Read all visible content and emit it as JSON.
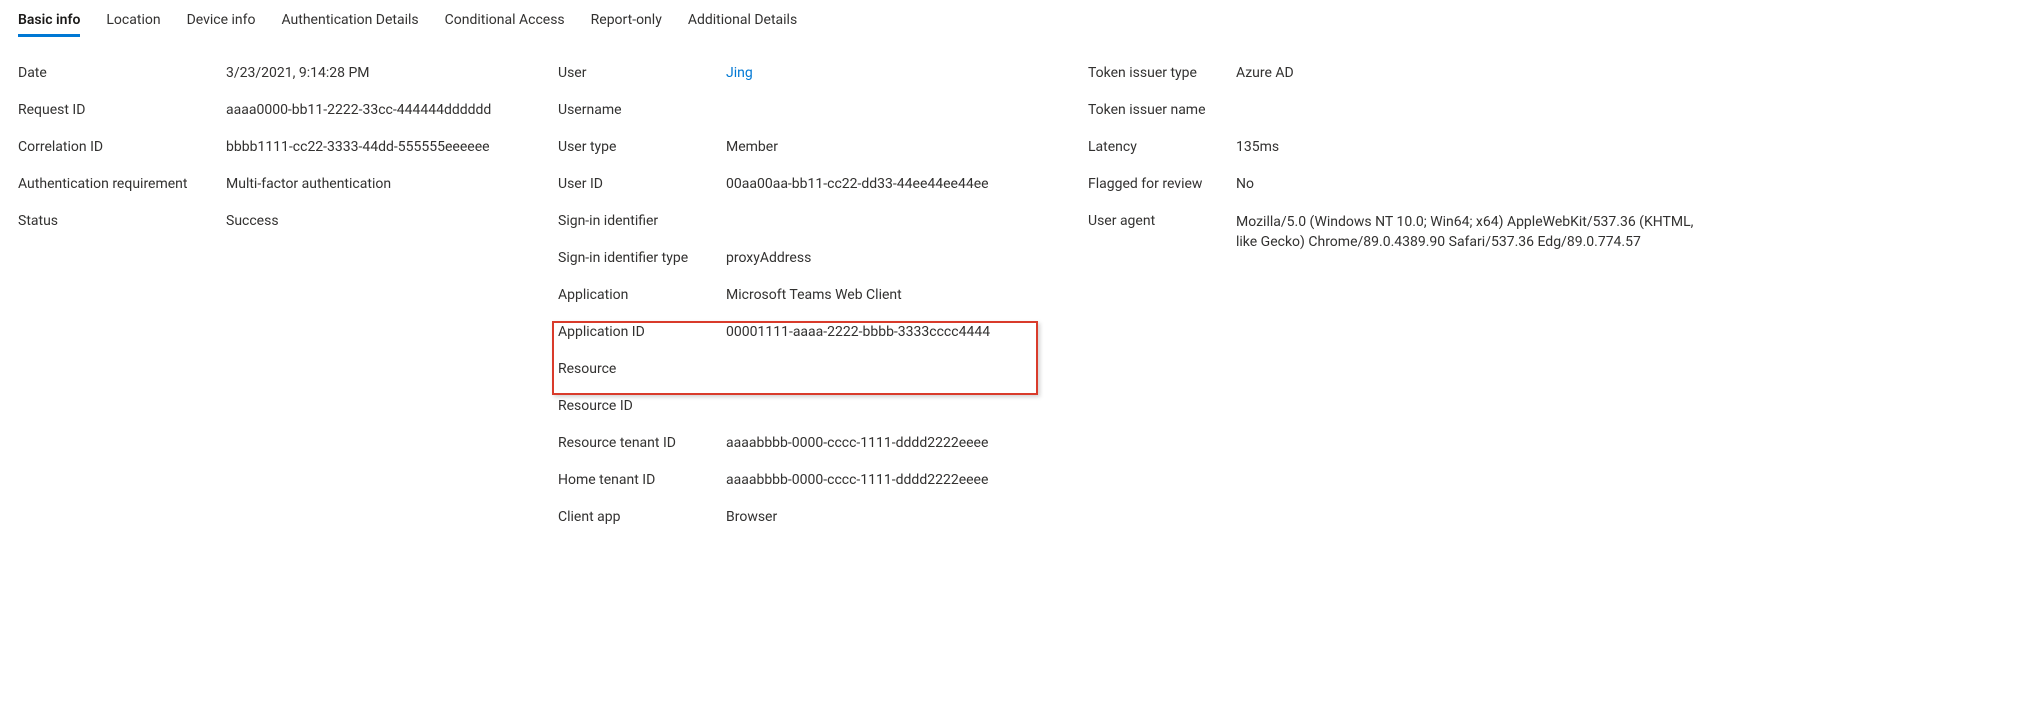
{
  "tabs": {
    "basic_info": "Basic info",
    "location": "Location",
    "device_info": "Device info",
    "auth_details": "Authentication Details",
    "conditional_access": "Conditional Access",
    "report_only": "Report-only",
    "additional_details": "Additional Details"
  },
  "col1": {
    "date_k": "Date",
    "date_v": "3/23/2021, 9:14:28 PM",
    "request_id_k": "Request ID",
    "request_id_v": "aaaa0000-bb11-2222-33cc-444444dddddd",
    "correlation_id_k": "Correlation ID",
    "correlation_id_v": "bbbb1111-cc22-3333-44dd-555555eeeeee",
    "auth_req_k": "Authentication requirement",
    "auth_req_v": "Multi-factor authentication",
    "status_k": "Status",
    "status_v": "Success"
  },
  "col2": {
    "user_k": "User",
    "user_v": "Jing",
    "username_k": "Username",
    "username_v": "",
    "user_type_k": "User type",
    "user_type_v": "Member",
    "user_id_k": "User ID",
    "user_id_v": "00aa00aa-bb11-cc22-dd33-44ee44ee44ee",
    "signin_id_k": "Sign-in identifier",
    "signin_id_v": "",
    "signin_id_type_k": "Sign-in identifier type",
    "signin_id_type_v": "proxyAddress",
    "application_k": "Application",
    "application_v": "Microsoft Teams Web Client",
    "application_id_k": "Application ID",
    "application_id_v": "00001111-aaaa-2222-bbbb-3333cccc4444",
    "resource_k": "Resource",
    "resource_v": "",
    "resource_id_k": "Resource ID",
    "resource_id_v": "",
    "resource_tenant_id_k": "Resource tenant ID",
    "resource_tenant_id_v": "aaaabbbb-0000-cccc-1111-dddd2222eeee",
    "home_tenant_id_k": "Home tenant ID",
    "home_tenant_id_v": "aaaabbbb-0000-cccc-1111-dddd2222eeee",
    "client_app_k": "Client app",
    "client_app_v": "Browser"
  },
  "col3": {
    "token_issuer_type_k": "Token issuer type",
    "token_issuer_type_v": "Azure AD",
    "token_issuer_name_k": "Token issuer name",
    "token_issuer_name_v": "",
    "latency_k": "Latency",
    "latency_v": "135ms",
    "flagged_k": "Flagged for review",
    "flagged_v": "No",
    "user_agent_k": "User agent",
    "user_agent_v": "Mozilla/5.0 (Windows NT 10.0; Win64; x64) AppleWebKit/537.36 (KHTML, like Gecko) Chrome/89.0.4389.90 Safari/537.36 Edg/89.0.774.57"
  }
}
